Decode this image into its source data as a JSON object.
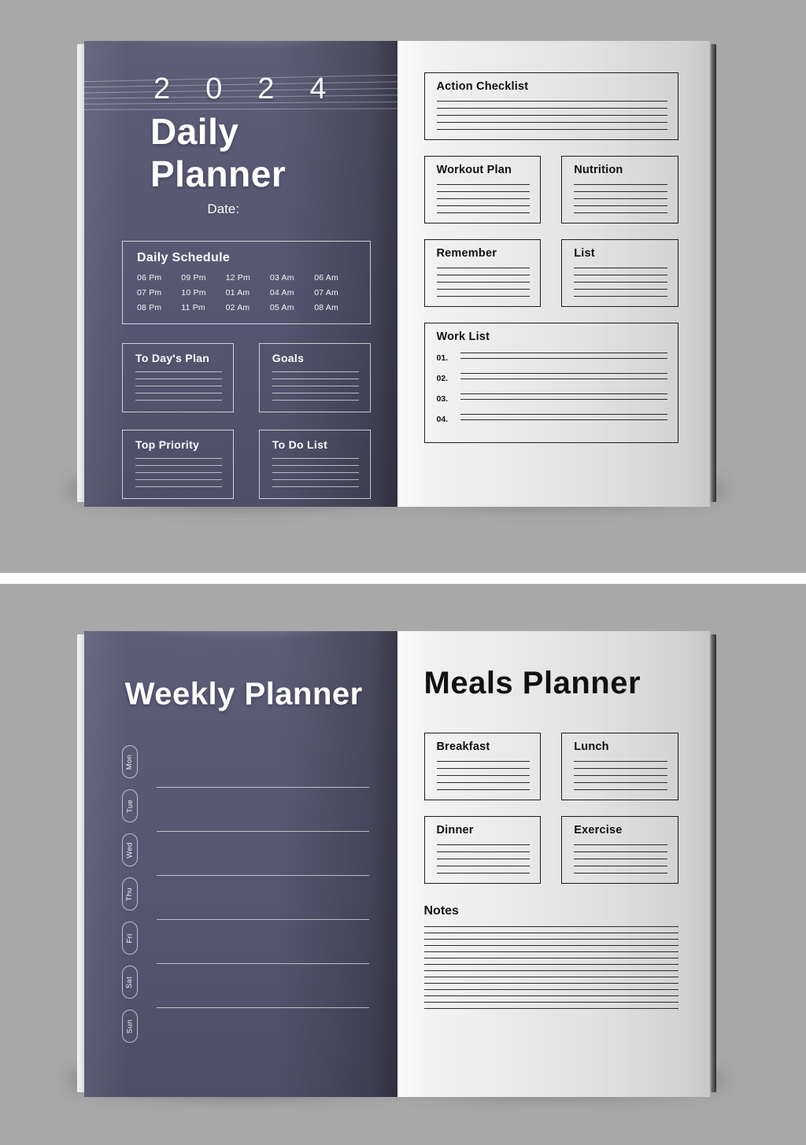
{
  "colors": {
    "background": "#a8a8a8",
    "page_purple": "#575672",
    "page_white": "#ededed",
    "ink": "#1d1d1d",
    "rule_light": "rgba(255,255,255,0.62)"
  },
  "spread_daily": {
    "left_page": {
      "year": [
        "2",
        "0",
        "2",
        "4"
      ],
      "title": "Daily Planner",
      "date_label": "Date:",
      "schedule": {
        "title": "Daily Schedule",
        "times": [
          "06 Pm",
          "09 Pm",
          "12 Pm",
          "03 Am",
          "06 Am",
          "07 Pm",
          "10 Pm",
          "01 Am",
          "04 Am",
          "07 Am",
          "08 Pm",
          "11 Pm",
          "02 Am",
          "05 Am",
          "08 Am"
        ]
      },
      "boxes": [
        {
          "title": "To Day's Plan",
          "lines": 5
        },
        {
          "title": "Goals",
          "lines": 5
        },
        {
          "title": "Top Priority",
          "lines": 5
        },
        {
          "title": "To Do List",
          "lines": 5
        }
      ]
    },
    "right_page": {
      "action_checklist": {
        "title": "Action Checklist",
        "lines": 5
      },
      "pair_one": [
        {
          "title": "Workout Plan",
          "lines": 5
        },
        {
          "title": "Nutrition",
          "lines": 5
        }
      ],
      "pair_two": [
        {
          "title": "Remember",
          "lines": 5
        },
        {
          "title": "List",
          "lines": 5
        }
      ],
      "work_list": {
        "title": "Work List",
        "items": [
          "01.",
          "02.",
          "03.",
          "04."
        ],
        "lines_per_item": 2
      }
    }
  },
  "spread_weekly": {
    "left_page": {
      "title": "Weekly Planner",
      "days": [
        "Mon",
        "Tue",
        "Wed",
        "Thu",
        "Fri",
        "Sat",
        "Sun"
      ]
    },
    "right_page": {
      "title": "Meals Planner",
      "pair_one": [
        {
          "title": "Breakfast",
          "lines": 5
        },
        {
          "title": "Lunch",
          "lines": 5
        }
      ],
      "pair_two": [
        {
          "title": "Dinner",
          "lines": 5
        },
        {
          "title": "Exercise",
          "lines": 5
        }
      ],
      "notes": {
        "title": "Notes",
        "lines": 14
      }
    }
  }
}
